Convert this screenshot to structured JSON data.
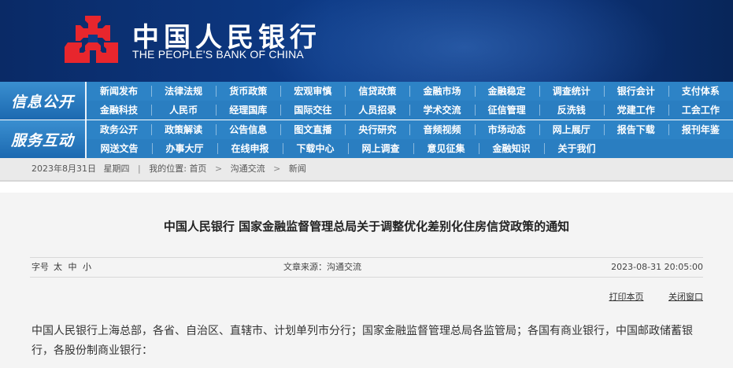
{
  "header": {
    "bank_name_cn": "中国人民银行",
    "bank_name_en": "THE PEOPLE'S BANK OF CHINA",
    "logo_color": "#e8262d"
  },
  "nav": {
    "section1_title": "信息公开",
    "section1_row1": [
      "新闻发布",
      "法律法规",
      "货币政策",
      "宏观审慎",
      "信贷政策",
      "金融市场",
      "金融稳定",
      "调查统计",
      "银行会计",
      "支付体系"
    ],
    "section1_row2": [
      "金融科技",
      "人民币",
      "经理国库",
      "国际交往",
      "人员招录",
      "学术交流",
      "征信管理",
      "反洗钱",
      "党建工作",
      "工会工作"
    ],
    "section2_title": "服务互动",
    "section2_row1": [
      "政务公开",
      "政策解读",
      "公告信息",
      "图文直播",
      "央行研究",
      "音频视频",
      "市场动态",
      "网上展厅",
      "报告下载",
      "报刊年鉴"
    ],
    "section2_row2": [
      "网送文告",
      "办事大厅",
      "在线申报",
      "下载中心",
      "网上调查",
      "意见征集",
      "金融知识",
      "关于我们"
    ]
  },
  "breadcrumb": {
    "date": "2023年8月31日",
    "weekday": "星期四",
    "location_label": "我的位置:",
    "home": "首页",
    "section": "沟通交流",
    "page": "新闻"
  },
  "article": {
    "title": "中国人民银行 国家金融监督管理总局关于调整优化差别化住房信贷政策的通知",
    "font_size_label": "字号",
    "font_sizes": [
      "太",
      "中",
      "小"
    ],
    "source": "文章来源：沟通交流",
    "timestamp": "2023-08-31 20:05:00",
    "print_label": "打印本页",
    "close_label": "关闭窗口",
    "body": "中国人民银行上海总部，各省、自治区、直辖市、计划单列市分行；国家金融监督管理总局各监管局；各国有商业银行，中国邮政储蓄银行，各股份制商业银行："
  }
}
